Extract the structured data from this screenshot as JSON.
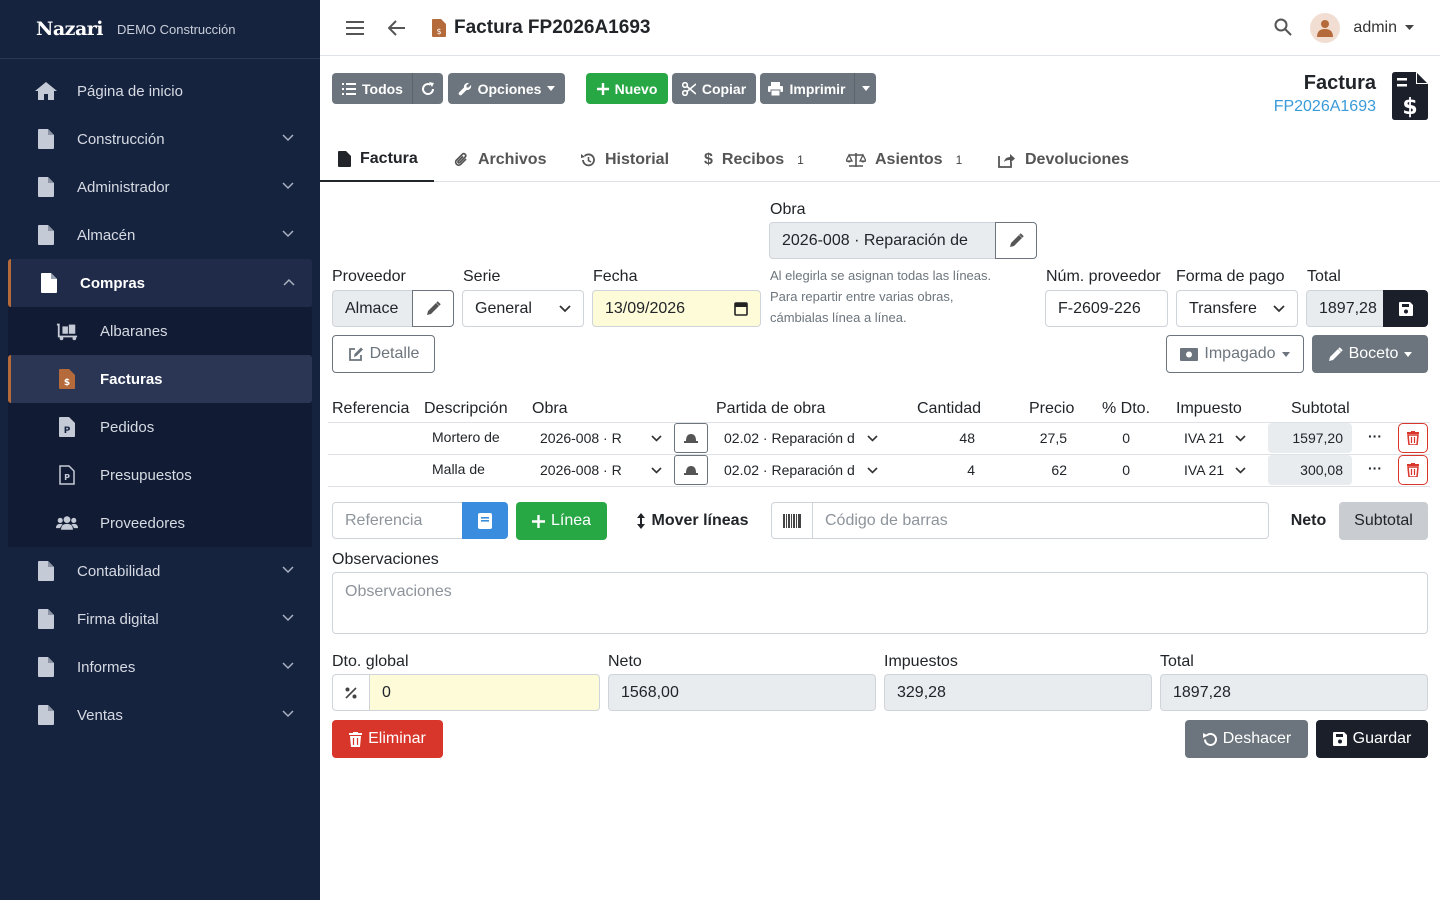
{
  "brand": {
    "logo": "Nazari",
    "company": "DEMO Construcción"
  },
  "sidebar": {
    "home": "Página de inicio",
    "items": [
      {
        "label": "Construcción"
      },
      {
        "label": "Administrador"
      },
      {
        "label": "Almacén"
      },
      {
        "label": "Compras"
      }
    ],
    "compras_sub": [
      {
        "label": "Albaranes"
      },
      {
        "label": "Facturas"
      },
      {
        "label": "Pedidos"
      },
      {
        "label": "Presupuestos"
      },
      {
        "label": "Proveedores"
      }
    ],
    "bottom": [
      {
        "label": "Contabilidad"
      },
      {
        "label": "Firma digital"
      },
      {
        "label": "Informes"
      },
      {
        "label": "Ventas"
      }
    ]
  },
  "topbar": {
    "title": "Factura FP2026A1693",
    "user": "admin"
  },
  "toolbar": {
    "todos": "Todos",
    "opciones": "Opciones",
    "nuevo": "Nuevo",
    "copiar": "Copiar",
    "imprimir": "Imprimir"
  },
  "header": {
    "type": "Factura",
    "number": "FP2026A1693"
  },
  "tabs": [
    {
      "label": "Factura"
    },
    {
      "label": "Archivos"
    },
    {
      "label": "Historial"
    },
    {
      "label": "Recibos",
      "badge": "1"
    },
    {
      "label": "Asientos",
      "badge": "1"
    },
    {
      "label": "Devoluciones"
    }
  ],
  "form": {
    "obra_label": "Obra",
    "obra_value": "2026-008 · Reparación de",
    "obra_hint": [
      "Al elegirla se asignan todas las líneas.",
      "Para repartir entre varias obras,",
      "cámbialas línea a línea."
    ],
    "proveedor_label": "Proveedor",
    "proveedor_value": "Almace",
    "serie_label": "Serie",
    "serie_value": "General",
    "fecha_label": "Fecha",
    "fecha_value": "13/09/2026",
    "numprov_label": "Núm. proveedor",
    "numprov_value": "F-2609-226",
    "formapago_label": "Forma de pago",
    "formapago_value": "Transfere",
    "total_label": "Total",
    "total_value": "1897,28",
    "detalle": "Detalle",
    "impagado": "Impagado",
    "boceto": "Boceto"
  },
  "lines": {
    "headers": [
      "Referencia",
      "Descripción",
      "Obra",
      "Partida de obra",
      "Cantidad",
      "Precio",
      "% Dto.",
      "Impuesto",
      "Subtotal"
    ],
    "rows": [
      {
        "descripcion": "Mortero de",
        "obra": "2026-008 · R",
        "partida": "02.02 · Reparación d",
        "cantidad": "48",
        "precio": "27,5",
        "dto": "0",
        "impuesto": "IVA 21",
        "subtotal": "1597,20"
      },
      {
        "descripcion": "Malla de",
        "obra": "2026-008 · R",
        "partida": "02.02 · Reparación d",
        "cantidad": "4",
        "precio": "62",
        "dto": "0",
        "impuesto": "IVA 21",
        "subtotal": "300,08"
      }
    ]
  },
  "actions": {
    "referencia_placeholder": "Referencia",
    "linea": "Línea",
    "mover": "Mover líneas",
    "barcode_placeholder": "Código de barras",
    "neto": "Neto",
    "subtotal": "Subtotal"
  },
  "obs": {
    "label": "Observaciones",
    "placeholder": "Observaciones"
  },
  "totals": {
    "dto_label": "Dto. global",
    "dto_value": "0",
    "neto_label": "Neto",
    "neto_value": "1568,00",
    "imp_label": "Impuestos",
    "imp_value": "329,28",
    "total_label": "Total",
    "total_value": "1897,28"
  },
  "footer": {
    "eliminar": "Eliminar",
    "deshacer": "Deshacer",
    "guardar": "Guardar"
  },
  "colors": {
    "sidebar": "#16233f",
    "accent": "#b56a3c",
    "green": "#28a745",
    "red": "#d9362b",
    "link": "#3a9ad9"
  }
}
